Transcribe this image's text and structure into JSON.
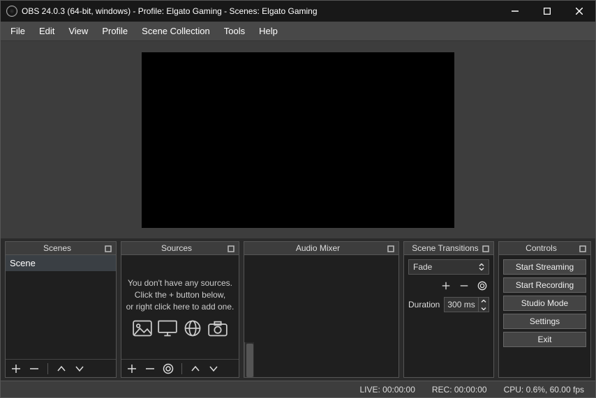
{
  "window": {
    "title": "OBS 24.0.3 (64-bit, windows) - Profile: Elgato Gaming - Scenes: Elgato Gaming"
  },
  "menu": {
    "items": [
      "File",
      "Edit",
      "View",
      "Profile",
      "Scene Collection",
      "Tools",
      "Help"
    ]
  },
  "scenes": {
    "header": "Scenes",
    "items": [
      "Scene"
    ]
  },
  "sources": {
    "header": "Sources",
    "empty_line1": "You don't have any sources.",
    "empty_line2": "Click the + button below,",
    "empty_line3": "or right click here to add one."
  },
  "mixer": {
    "header": "Audio Mixer"
  },
  "transitions": {
    "header": "Scene Transitions",
    "selected": "Fade",
    "duration_label": "Duration",
    "duration_value": "300 ms"
  },
  "controls": {
    "header": "Controls",
    "buttons": [
      "Start Streaming",
      "Start Recording",
      "Studio Mode",
      "Settings",
      "Exit"
    ]
  },
  "status": {
    "live": "LIVE: 00:00:00",
    "rec": "REC: 00:00:00",
    "cpu": "CPU: 0.6%, 60.00 fps"
  }
}
